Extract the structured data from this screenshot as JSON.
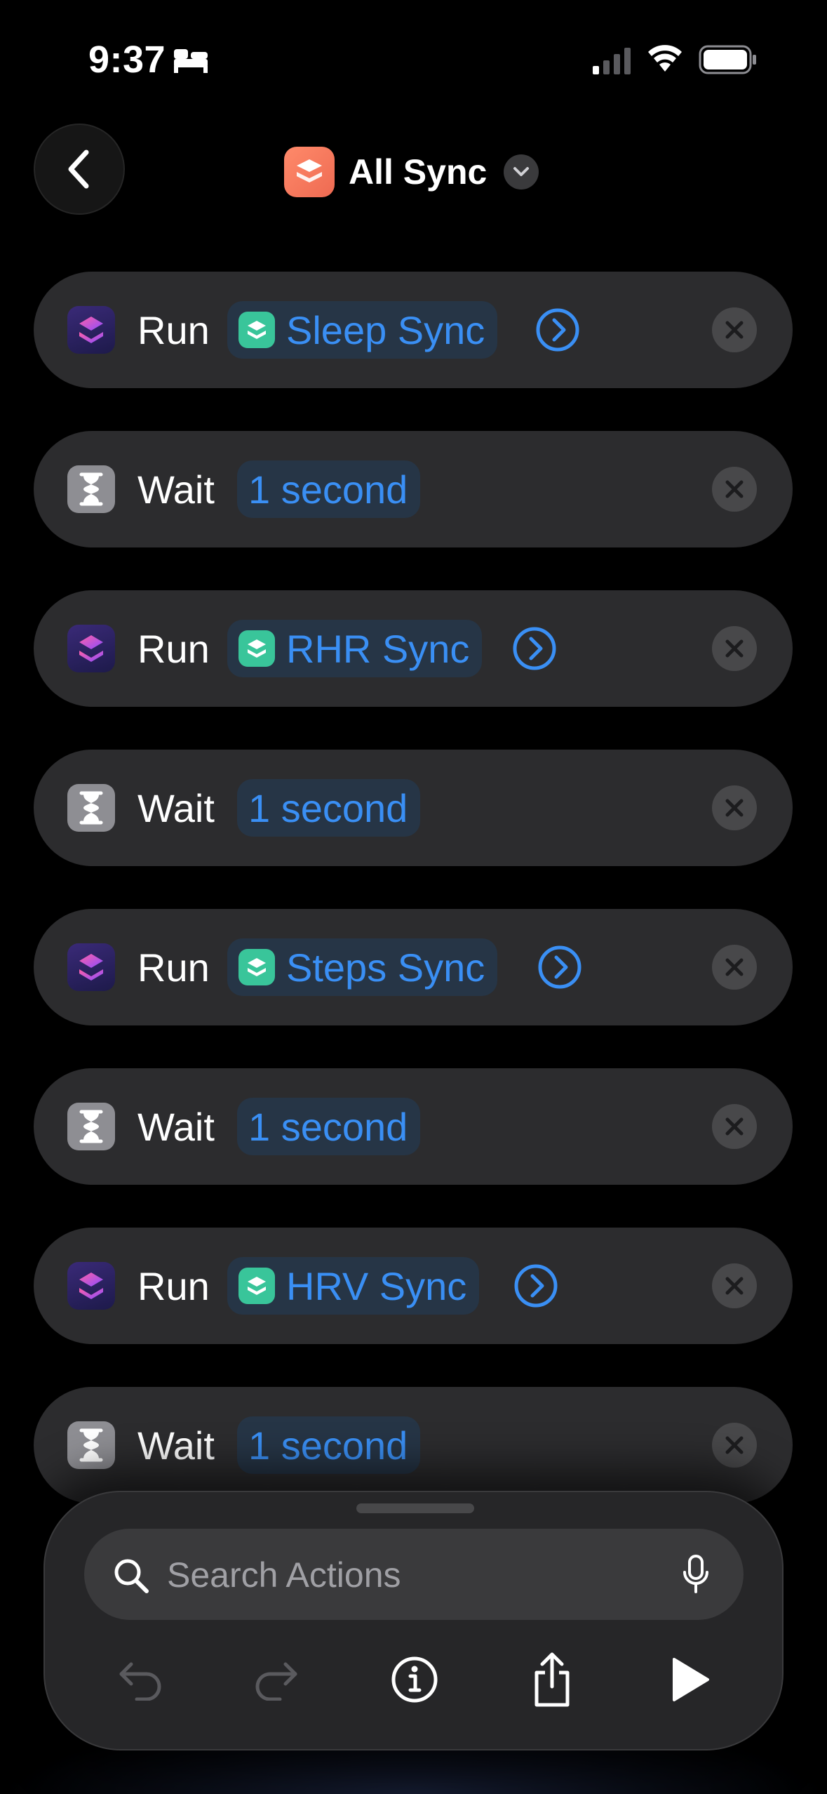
{
  "status_bar": {
    "time": "9:37",
    "icons": [
      "bed-icon",
      "cellular-signal-icon",
      "wifi-icon",
      "battery-icon"
    ]
  },
  "header": {
    "back_icon": "chevron-left-icon",
    "app_icon": "shortcuts-stack-icon",
    "title": "All Sync",
    "menu_icon": "chevron-down-icon"
  },
  "actions": [
    {
      "type": "run",
      "label": "Run",
      "target": "Sleep Sync"
    },
    {
      "type": "wait",
      "label": "Wait",
      "target": "1 second"
    },
    {
      "type": "run",
      "label": "Run",
      "target": "RHR Sync"
    },
    {
      "type": "wait",
      "label": "Wait",
      "target": "1 second"
    },
    {
      "type": "run",
      "label": "Run",
      "target": "Steps Sync"
    },
    {
      "type": "wait",
      "label": "Wait",
      "target": "1 second"
    },
    {
      "type": "run",
      "label": "Run",
      "target": "HRV Sync"
    },
    {
      "type": "wait",
      "label": "Wait",
      "target": "1 second"
    }
  ],
  "bottom_sheet": {
    "search_placeholder": "Search Actions",
    "toolbar": [
      "undo-icon",
      "redo-icon",
      "info-icon",
      "share-icon",
      "play-icon"
    ]
  },
  "colors": {
    "accent": "#3a8ff4",
    "row_bg": "#2c2c2e",
    "app_icon": "#ef6e55",
    "shortcut_icon": "#39c59a"
  }
}
